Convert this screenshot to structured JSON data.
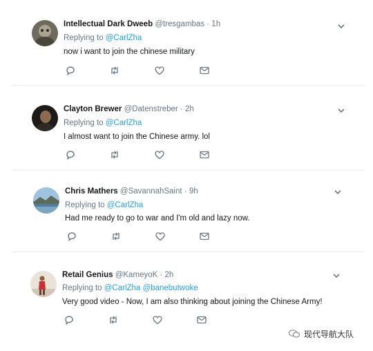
{
  "tweets": [
    {
      "name": "Intellectual Dark Dweeb",
      "handle": "@tresgambas",
      "time": "1h",
      "replying_prefix": "Replying to",
      "mentions": [
        "@CarlZha"
      ],
      "text": "now i want to join the chinese military"
    },
    {
      "name": "Clayton Brewer",
      "handle": "@Datenstreber",
      "time": "2h",
      "replying_prefix": "Replying to",
      "mentions": [
        "@CarlZha"
      ],
      "text": "I almost want to join the Chinese army. lol"
    },
    {
      "name": "Chris Mathers",
      "handle": "@SavannahSaint",
      "time": "9h",
      "replying_prefix": "Replying to",
      "mentions": [
        "@CarlZha"
      ],
      "text": "Had me ready to go to war and I'm old and lazy now."
    },
    {
      "name": "Retail Genius",
      "handle": "@KameyoK",
      "time": "2h",
      "replying_prefix": "Replying to",
      "mentions": [
        "@CarlZha",
        "@banebutwoke"
      ],
      "text": "Very good video - Now, I am also thinking about joining the Chinese Army!"
    }
  ],
  "watermark": {
    "text": "现代导航大队"
  },
  "icons": [
    "reply-icon",
    "retweet-icon",
    "like-icon",
    "message-icon",
    "chevron-down-icon"
  ],
  "colors": {
    "link": "#1da1f2",
    "muted": "#657786",
    "text": "#14171a",
    "divider": "#e6ecf0"
  }
}
